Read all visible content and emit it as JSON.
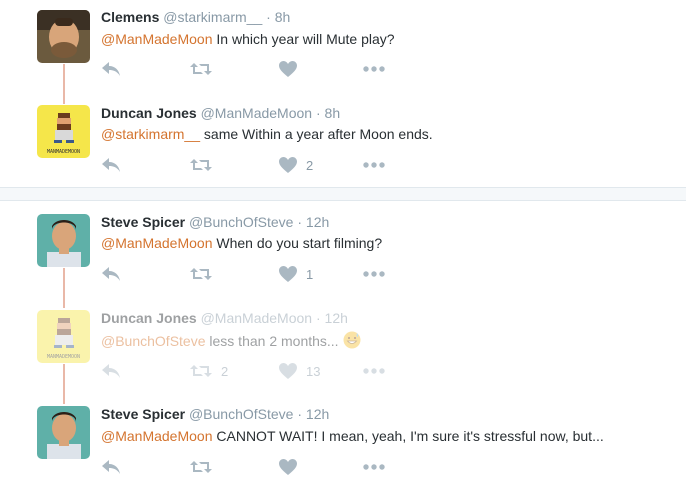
{
  "tweets": [
    {
      "name": "Clemens",
      "handle": "@starkimarm__",
      "dot": "·",
      "time": "8h",
      "mention": "@ManMadeMoon",
      "text": " In which year will Mute play?",
      "like_count": "",
      "retweet_count": ""
    },
    {
      "name": "Duncan Jones",
      "handle": "@ManMadeMoon",
      "dot": "·",
      "time": "8h",
      "mention": "@starkimarm__",
      "text": " same Within a year after Moon ends.",
      "like_count": "2",
      "retweet_count": "",
      "avatar_text": "MANMADEMOON"
    },
    {
      "name": "Steve Spicer",
      "handle": "@BunchOfSteve",
      "dot": "·",
      "time": "12h",
      "mention": "@ManMadeMoon",
      "text": " When do you start filming?",
      "like_count": "1",
      "retweet_count": ""
    },
    {
      "name": "Duncan Jones",
      "handle": "@ManMadeMoon",
      "dot": "·",
      "time": "12h",
      "mention": "@BunchOfSteve",
      "text": " less than 2 months...",
      "like_count": "13",
      "retweet_count": "2",
      "avatar_text": "MANMADEMOON",
      "emoji": "grinning-sweat-emoji"
    },
    {
      "name": "Steve Spicer",
      "handle": "@BunchOfSteve",
      "dot": "·",
      "time": "12h",
      "mention": "@ManMadeMoon",
      "text": " CANNOT WAIT! I mean, yeah, I'm sure it's stressful now, but...",
      "like_count": "",
      "retweet_count": ""
    }
  ],
  "icons": {
    "reply": "reply-icon",
    "retweet": "retweet-icon",
    "like": "heart-icon",
    "more": "more-icon"
  },
  "colors": {
    "mention": "#d4742f",
    "muted": "#8899a6",
    "thread_line": "#e9b8a8",
    "text": "#292f33"
  }
}
